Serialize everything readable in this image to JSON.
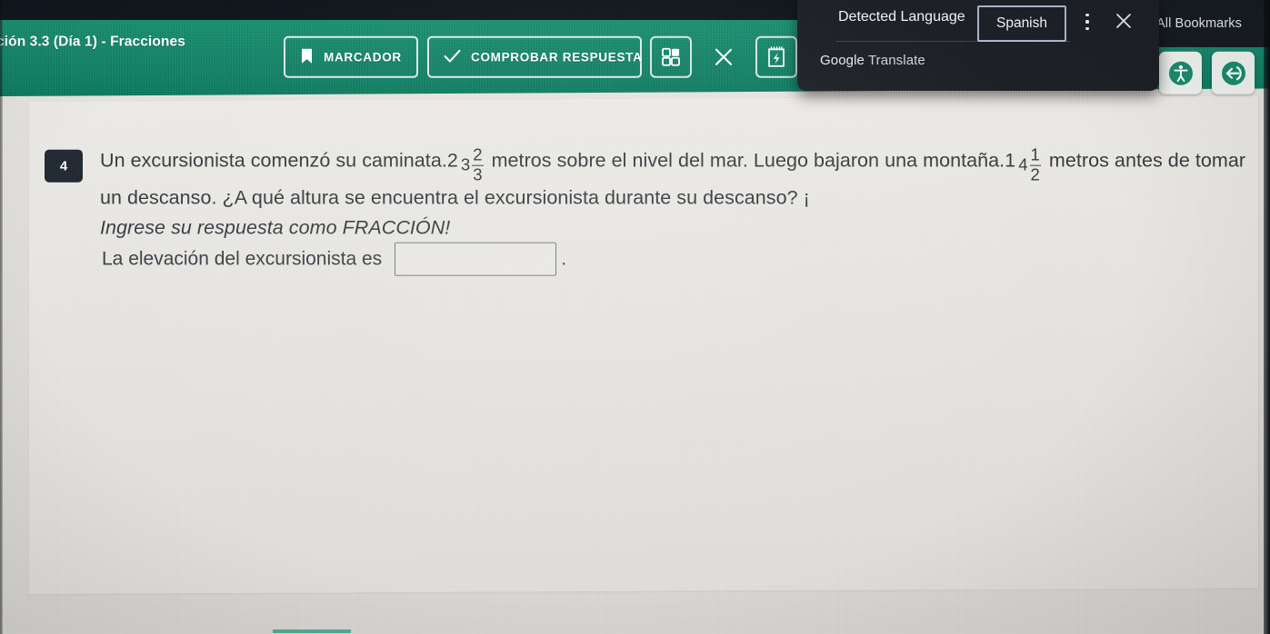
{
  "browser": {
    "bookmarks_label": "All Bookmarks",
    "bookmarks_icon": "folder-icon"
  },
  "translate_popup": {
    "detected_label": "Detected Language",
    "language_value": "Spanish",
    "menu_icon": "kebab-menu-icon",
    "close_icon": "close-icon",
    "brand_google": "Google",
    "brand_translate": " Translate"
  },
  "header": {
    "title": "ción 3.3 (Día 1) - Fracciones",
    "background_color": "#178469",
    "buttons": [
      {
        "label": "MARCADOR",
        "icon": "bookmark-icon"
      },
      {
        "label": "COMPROBAR RESPUESTA",
        "icon": "check-icon"
      }
    ],
    "icon_buttons": [
      {
        "name": "calculator-grid-icon"
      },
      {
        "name": "close-x-icon"
      },
      {
        "name": "scratchpad-icon"
      }
    ],
    "corner_buttons": [
      {
        "name": "accessibility-icon"
      },
      {
        "name": "exit-back-arrow-icon"
      }
    ]
  },
  "question": {
    "number": "4",
    "badge_color": "#222a33",
    "part1": "Un excursionista comenzó su caminata.2",
    "fraction1": {
      "whole": "3",
      "numerator": "2",
      "denominator": "3"
    },
    "part2": "metros sobre el nivel del mar. Luego bajaron una montaña.1",
    "fraction2": {
      "whole": "4",
      "numerator": "1",
      "denominator": "2"
    },
    "part3": "metros antes de tomar un descanso. ¿A qué altura se encuentra el excursionista durante su descanso? ¡",
    "part4_italic": "Ingrese su respuesta como FRACCIÓN!",
    "answer_prompt": "La elevación del excursionista es",
    "answer_value": "",
    "answer_placeholder": "",
    "answer_trailing": "."
  }
}
